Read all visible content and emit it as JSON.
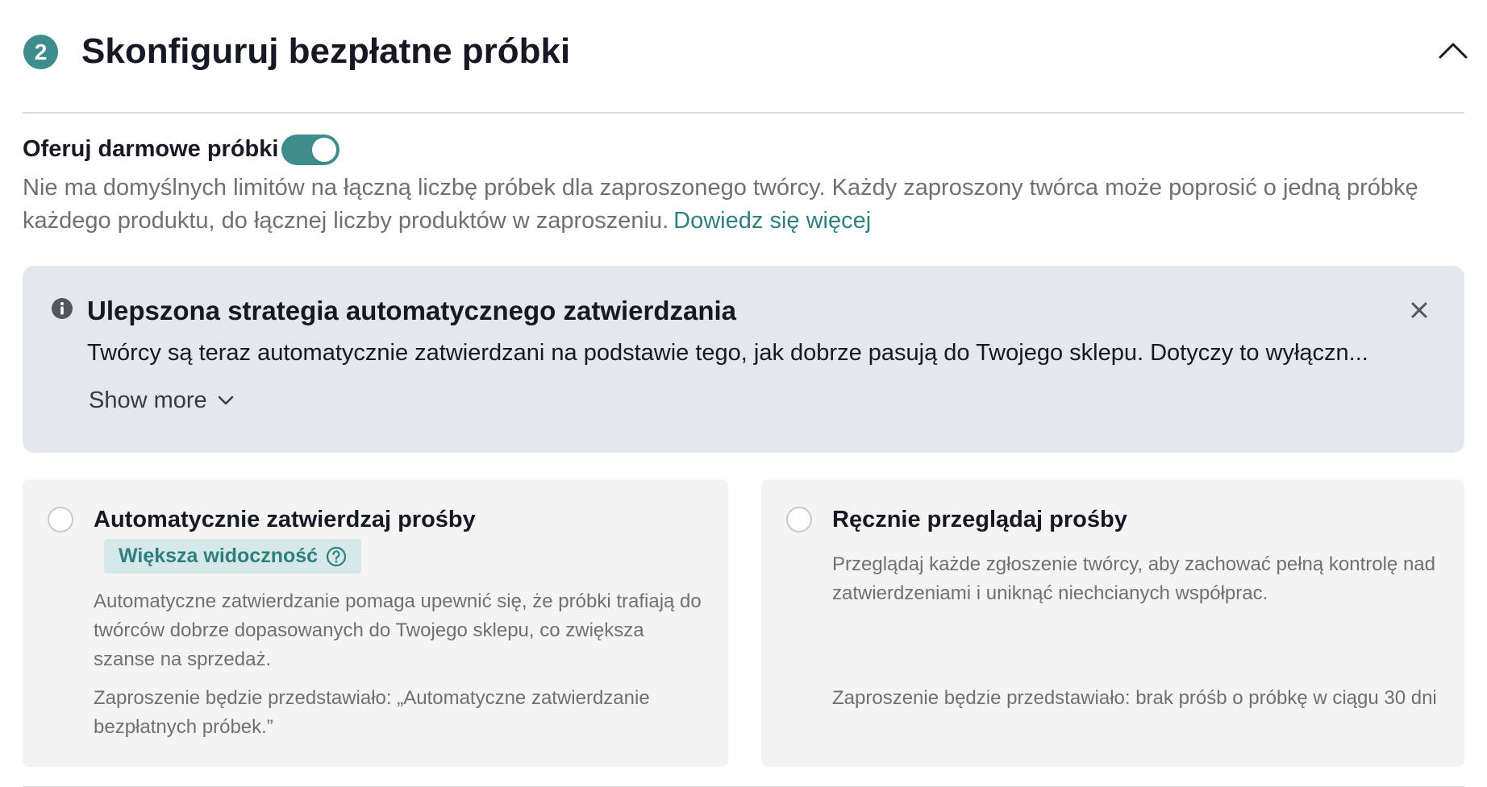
{
  "section": {
    "step_number": "2",
    "title": "Skonfiguruj bezpłatne próbki"
  },
  "free_samples": {
    "toggle_label": "Oferuj darmowe próbki",
    "toggle_on": true,
    "description": "Nie ma domyślnych limitów na łączną liczbę próbek dla zaproszonego twórcy. Każdy zaproszony twórca może poprosić o jedną próbkę każdego produktu, do łącznej liczby produktów w zaproszeniu.",
    "learn_more_link": "Dowiedz się więcej"
  },
  "banner": {
    "title": "Ulepszona strategia automatycznego zatwierdzania",
    "text": "Twórcy są teraz automatycznie zatwierdzani na podstawie tego, jak dobrze pasują do Twojego sklepu. Dotyczy to wyłączn...",
    "show_more": "Show more"
  },
  "options": {
    "auto": {
      "title": "Automatycznie zatwierdzaj prośby",
      "tag": "Większa widoczność",
      "description": "Automatyczne zatwierdzanie pomaga upewnić się, że próbki trafiają do twórców dobrze dopasowanych do Twojego sklepu, co zwiększa szanse na sprzedaż.",
      "invitation_note": "Zaproszenie będzie przedstawiało: „Automatyczne zatwierdzanie bezpłatnych próbek.”",
      "selected": false
    },
    "manual": {
      "title": "Ręcznie przeglądaj prośby",
      "description": "Przeglądaj każde zgłoszenie twórcy, aby zachować pełną kontrolę nad zatwierdzeniami i uniknąć niechcianych współprac.",
      "invitation_note": "Zaproszenie będzie przedstawiało: brak próśb o próbkę w ciągu 30 dni",
      "selected": false
    }
  },
  "colors": {
    "accent": "#3f8c8c",
    "banner_bg": "#e4e7ec",
    "card_bg": "#f4f4f4",
    "tag_bg": "#d6e8e7"
  }
}
